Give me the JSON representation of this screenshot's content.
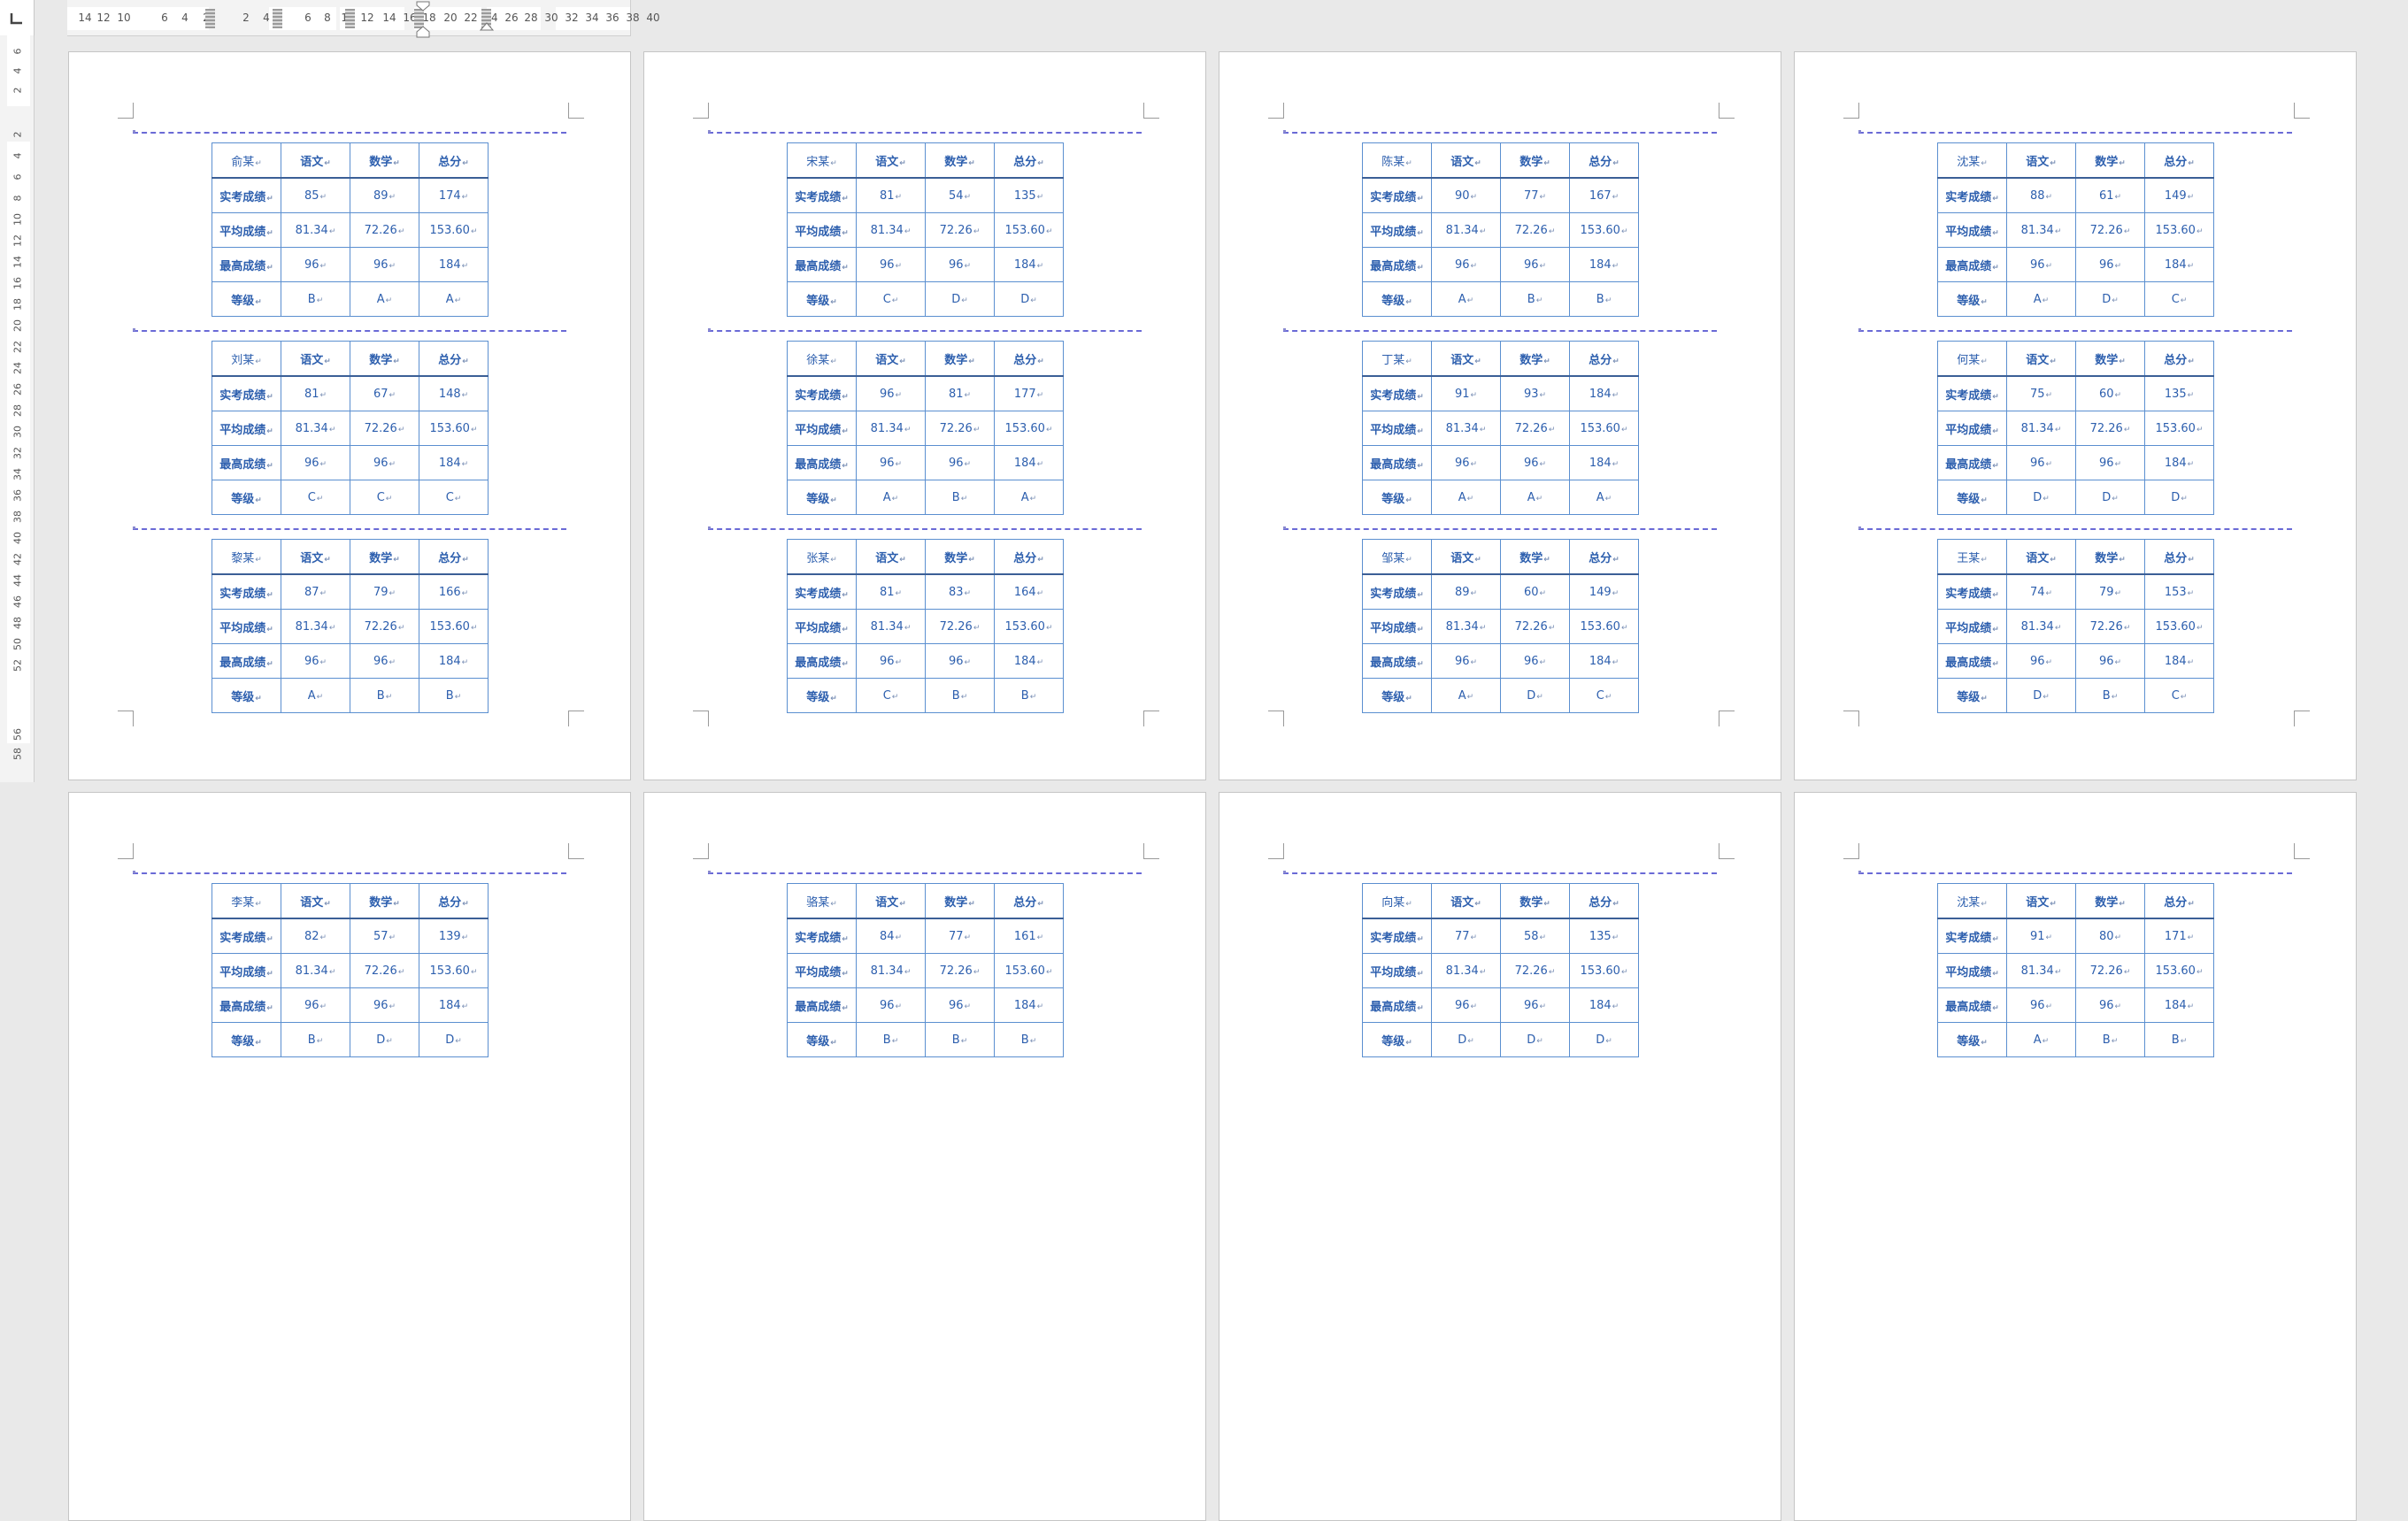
{
  "ruler": {
    "horizontal_labels": [
      "14",
      "12",
      "10",
      "6",
      "4",
      "2",
      "2",
      "4",
      "6",
      "8",
      "10",
      "12",
      "14",
      "16",
      "18",
      "20",
      "22",
      "24",
      "26",
      "28",
      "30",
      "32",
      "34",
      "36",
      "38",
      "40"
    ],
    "vertical_labels": [
      "6",
      "4",
      "2",
      "2",
      "4",
      "6",
      "8",
      "10",
      "12",
      "14",
      "16",
      "18",
      "20",
      "22",
      "24",
      "26",
      "28",
      "30",
      "32",
      "34",
      "36",
      "38",
      "40",
      "42",
      "44",
      "46",
      "48",
      "50",
      "52",
      "56",
      "58"
    ]
  },
  "table": {
    "subject_headers": [
      "语文",
      "数学",
      "总分"
    ],
    "row_labels": [
      "实考成绩",
      "平均成绩",
      "最高成绩",
      "等级"
    ],
    "average": [
      "81.34",
      "72.26",
      "153.60"
    ],
    "maximum": [
      "96",
      "96",
      "184"
    ],
    "paragraph_mark": "↵"
  },
  "pages": [
    {
      "cards": [
        {
          "name": "俞某",
          "scores": [
            "85",
            "89",
            "174"
          ],
          "grades": [
            "B",
            "A",
            "A"
          ]
        },
        {
          "name": "刘某",
          "scores": [
            "81",
            "67",
            "148"
          ],
          "grades": [
            "C",
            "C",
            "C"
          ]
        },
        {
          "name": "黎某",
          "scores": [
            "87",
            "79",
            "166"
          ],
          "grades": [
            "A",
            "B",
            "B"
          ]
        }
      ]
    },
    {
      "cards": [
        {
          "name": "宋某",
          "scores": [
            "81",
            "54",
            "135"
          ],
          "grades": [
            "C",
            "D",
            "D"
          ]
        },
        {
          "name": "徐某",
          "scores": [
            "96",
            "81",
            "177"
          ],
          "grades": [
            "A",
            "B",
            "A"
          ]
        },
        {
          "name": "张某",
          "scores": [
            "81",
            "83",
            "164"
          ],
          "grades": [
            "C",
            "B",
            "B"
          ]
        }
      ]
    },
    {
      "cards": [
        {
          "name": "陈某",
          "scores": [
            "90",
            "77",
            "167"
          ],
          "grades": [
            "A",
            "B",
            "B"
          ]
        },
        {
          "name": "丁某",
          "scores": [
            "91",
            "93",
            "184"
          ],
          "grades": [
            "A",
            "A",
            "A"
          ]
        },
        {
          "name": "邹某",
          "scores": [
            "89",
            "60",
            "149"
          ],
          "grades": [
            "A",
            "D",
            "C"
          ]
        }
      ]
    },
    {
      "cards": [
        {
          "name": "沈某",
          "scores": [
            "88",
            "61",
            "149"
          ],
          "grades": [
            "A",
            "D",
            "C"
          ]
        },
        {
          "name": "何某",
          "scores": [
            "75",
            "60",
            "135"
          ],
          "grades": [
            "D",
            "D",
            "D"
          ]
        },
        {
          "name": "王某",
          "scores": [
            "74",
            "79",
            "153"
          ],
          "grades": [
            "D",
            "B",
            "C"
          ]
        }
      ]
    },
    {
      "cards": [
        {
          "name": "李某",
          "scores": [
            "82",
            "57",
            "139"
          ],
          "grades": [
            "B",
            "D",
            "D"
          ]
        }
      ]
    },
    {
      "cards": [
        {
          "name": "骆某",
          "scores": [
            "84",
            "77",
            "161"
          ],
          "grades": [
            "B",
            "B",
            "B"
          ]
        }
      ]
    },
    {
      "cards": [
        {
          "name": "向某",
          "scores": [
            "77",
            "58",
            "135"
          ],
          "grades": [
            "D",
            "D",
            "D"
          ]
        }
      ]
    },
    {
      "cards": [
        {
          "name": "沈某",
          "scores": [
            "91",
            "80",
            "171"
          ],
          "grades": [
            "A",
            "B",
            "B"
          ]
        }
      ]
    }
  ]
}
